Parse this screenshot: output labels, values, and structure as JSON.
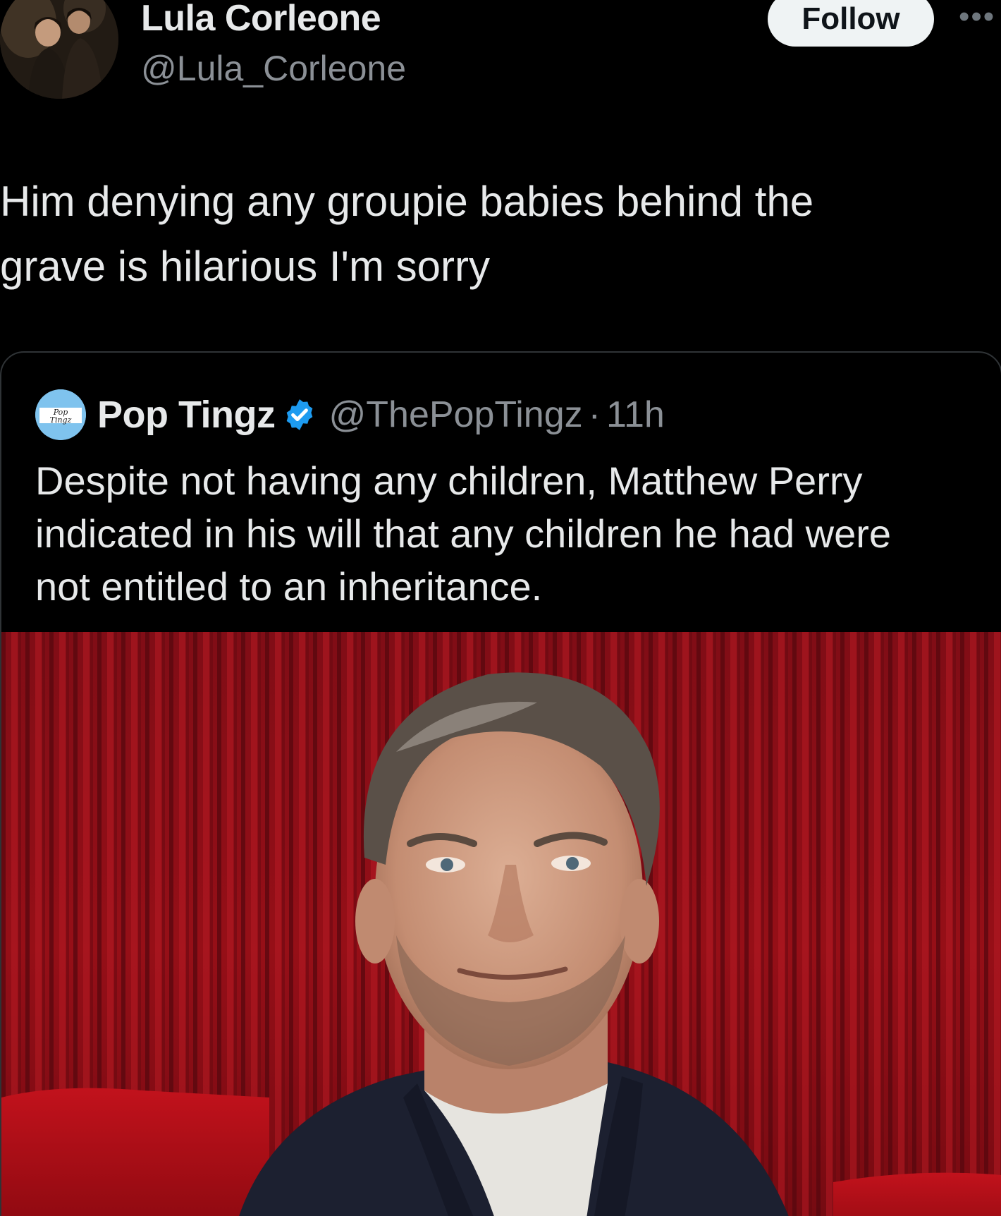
{
  "author": {
    "display_name": "Lula Corleone",
    "handle": "@Lula_Corleone",
    "avatar_icon": "profile-photo"
  },
  "actions": {
    "follow_label": "Follow",
    "more_label": "•••"
  },
  "tweet": {
    "lines": [
      "Him denying any groupie babies behind the",
      "grave is hilarious I'm sorry"
    ]
  },
  "quoted_tweet": {
    "display_name": "Pop Tingz",
    "verified": true,
    "verified_color": "#1d9bf0",
    "handle": "@ThePopTingz",
    "separator": "·",
    "time": "11h",
    "avatar_icon": "pop-tingz-logo",
    "avatar_text_line1": "Pop",
    "avatar_text_line2": "Tingz",
    "lines": [
      "Despite not having any children, Matthew Perry",
      "indicated in his will that any children he had were",
      "not entitled to an inheritance."
    ],
    "photo": {
      "subject": "man-portrait-red-curtain",
      "background_color": "#a3111a"
    }
  },
  "colors": {
    "background": "#000000",
    "text_primary": "#e7e9ea",
    "text_secondary": "#8b9096",
    "follow_bg": "#eff3f4",
    "card_border": "#2f3336"
  }
}
